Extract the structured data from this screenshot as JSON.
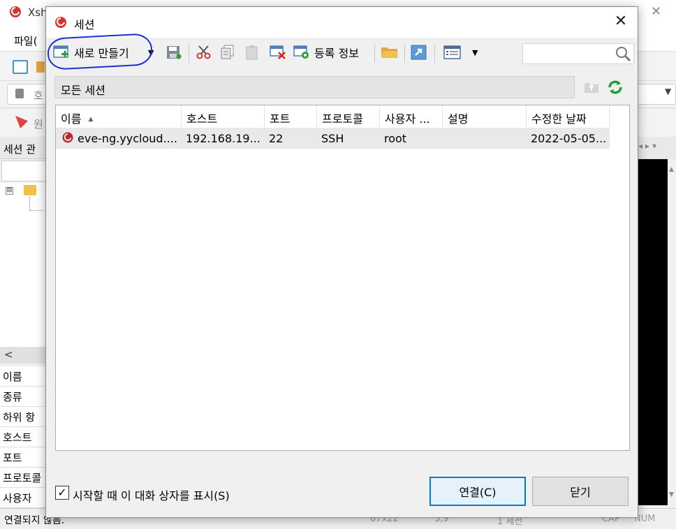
{
  "background_window": {
    "title": "Xsh",
    "menu_file": "파일(",
    "address_placeholder": "호",
    "link_text": "원",
    "panel_title": "세션 관",
    "tree_toggle": "⊟",
    "properties": [
      "이름",
      "종류",
      "하위 항",
      "호스트",
      "포트",
      "프로토콜",
      "사용자"
    ],
    "status_text": "연결되지 않음.",
    "status_items": [
      "67x22",
      "3,9",
      "1 세션",
      "CAP",
      "NUM"
    ]
  },
  "dialog": {
    "title": "세션",
    "close_glyph": "✕",
    "toolbar": {
      "new_label": "새로 만들기",
      "properties_label": "등록 정보"
    },
    "search": {
      "value": ""
    },
    "path": "모든 세션",
    "columns": [
      "이름",
      "호스트",
      "포트",
      "프로토콜",
      "사용자 ...",
      "설명",
      "수정한 날짜"
    ],
    "sessions": [
      {
        "name": "eve-ng.yycloud....",
        "host": "192.168.19...",
        "port": "22",
        "protocol": "SSH",
        "user": "root",
        "description": "",
        "modified": "2022-05-05..."
      }
    ],
    "show_on_startup_label": "시작할 때 이 대화 상자를 표시(S)",
    "show_on_startup_checked": "✓",
    "connect_label": "연결(C)",
    "close_label": "닫기"
  },
  "colors": {
    "accent": "#0078d7",
    "highlight_annotation": "#1a2fd6",
    "app_icon": "#d9342b",
    "refresh": "#1e9e3a"
  }
}
